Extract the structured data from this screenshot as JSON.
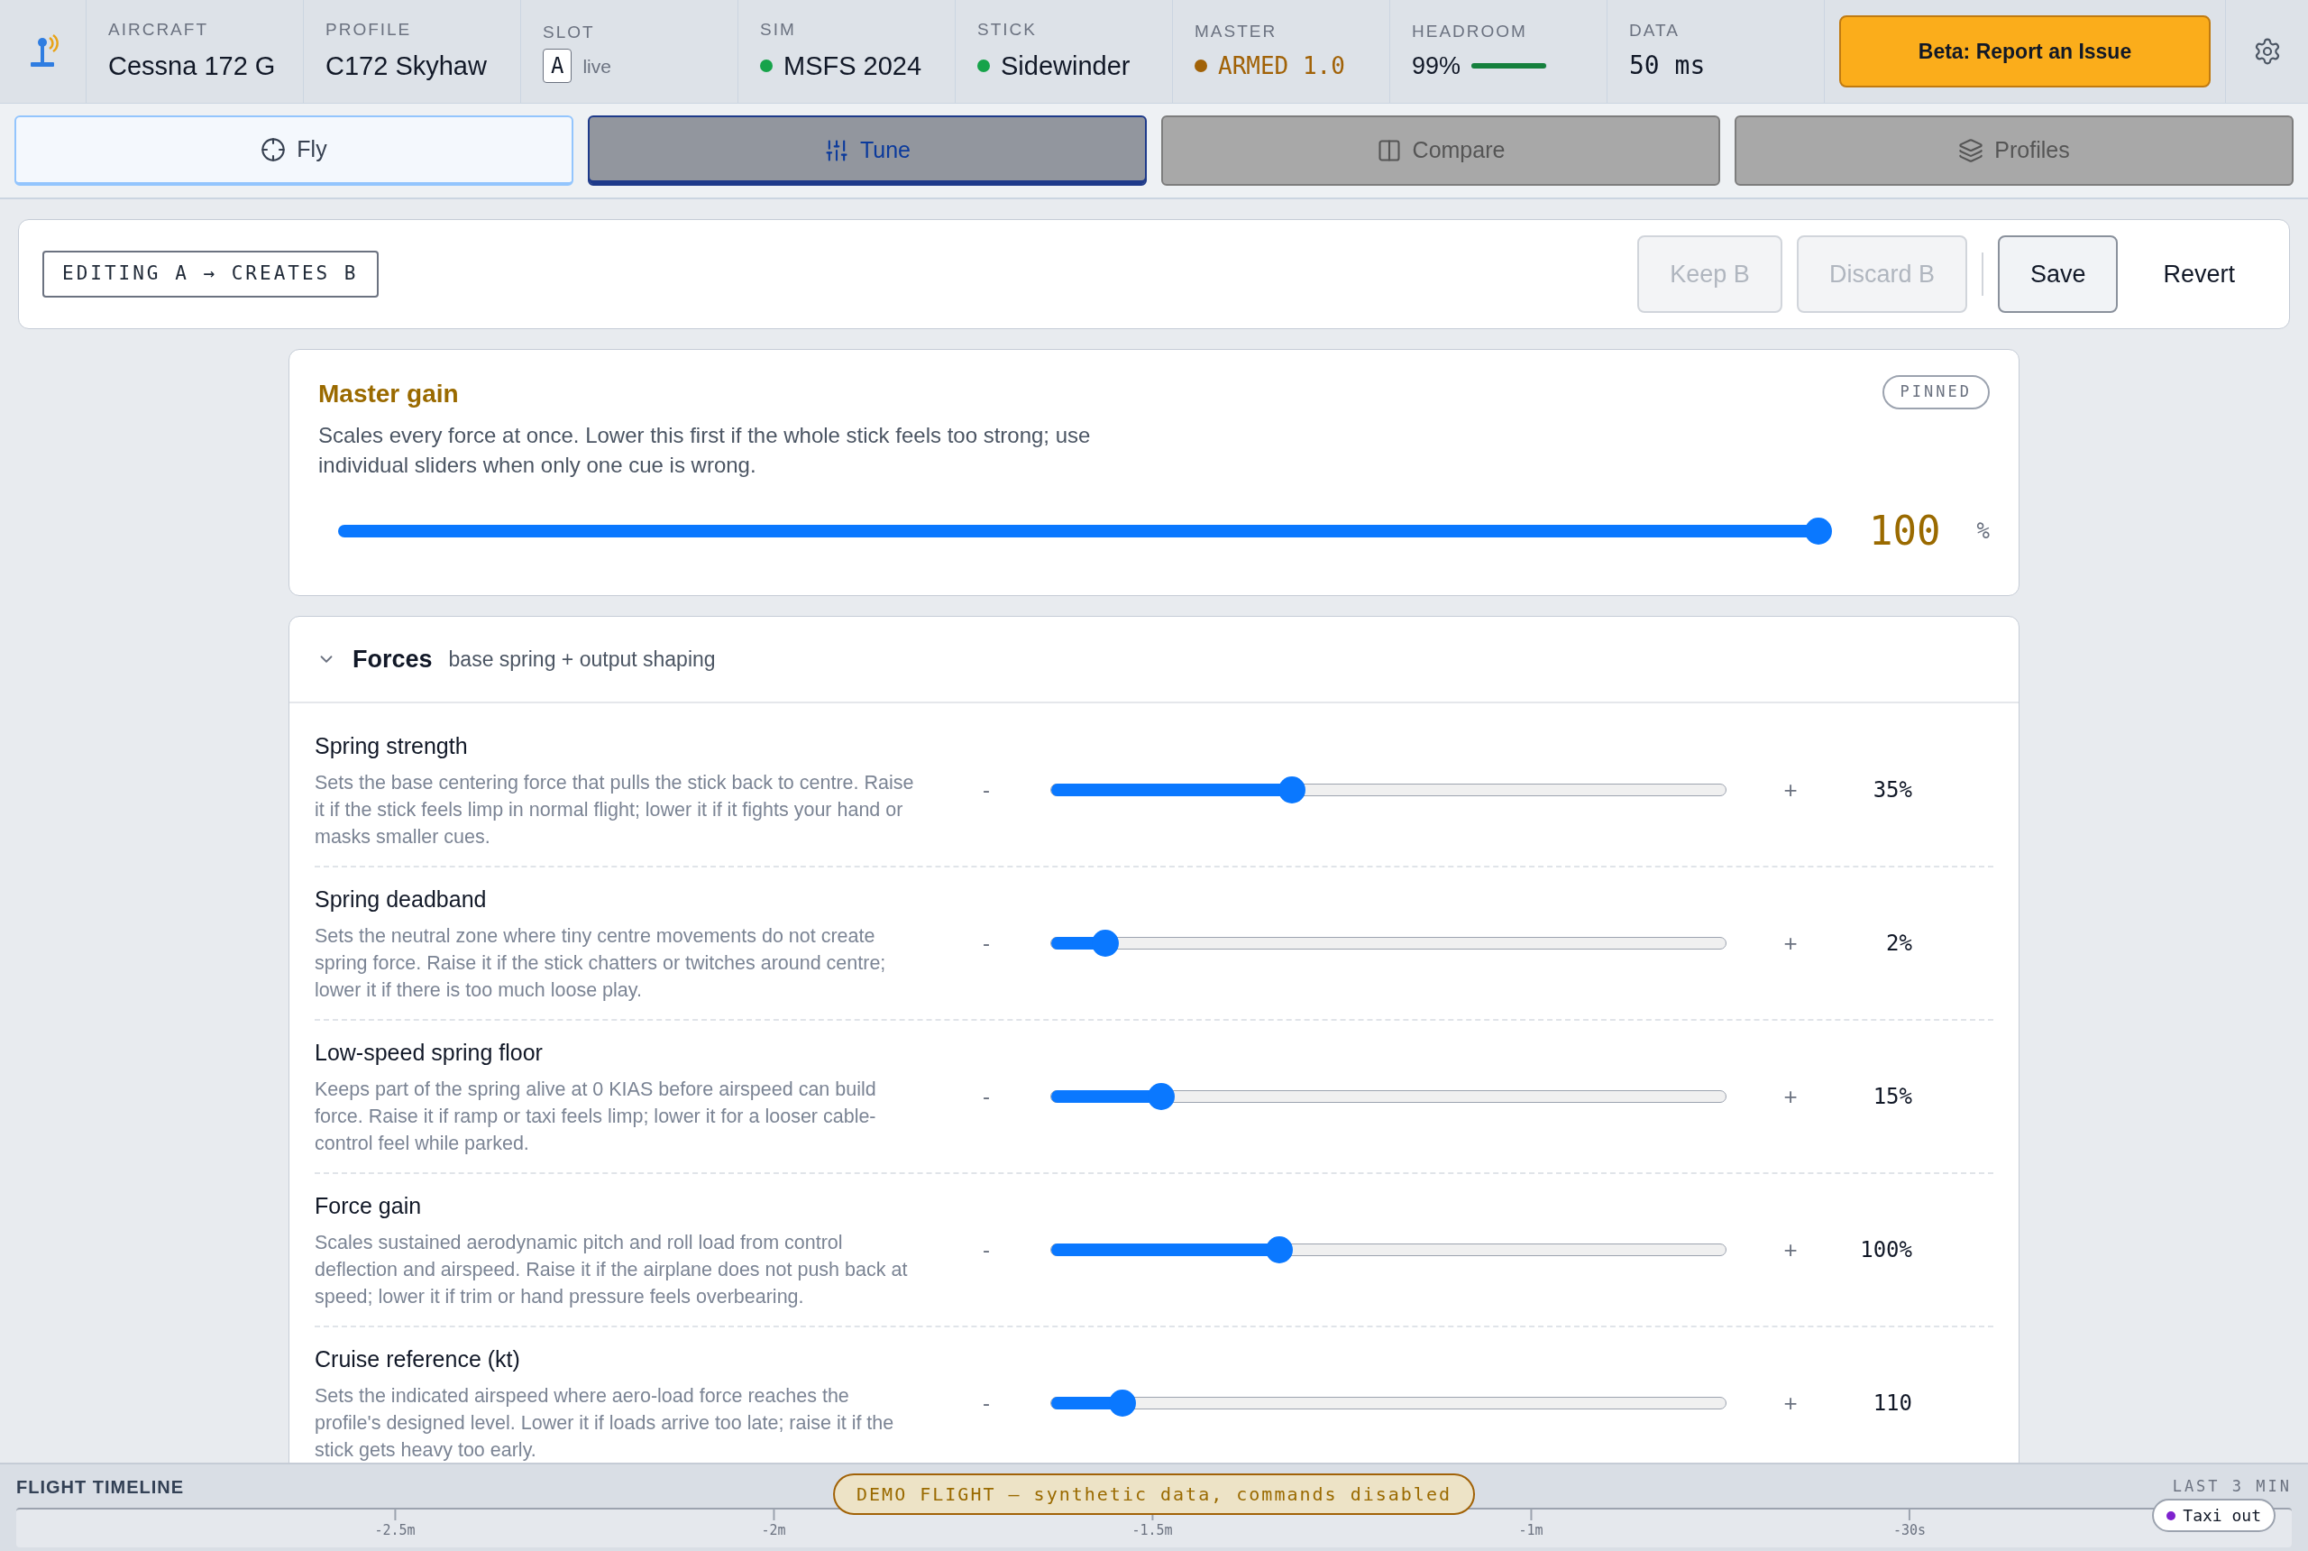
{
  "header": {
    "fields": [
      {
        "label": "AIRCRAFT",
        "value": "Cessna 172 G",
        "kind": "text"
      },
      {
        "label": "PROFILE",
        "value": "C172 Skyhaw",
        "kind": "text"
      },
      {
        "label": "SLOT",
        "slot": "A",
        "value": "live",
        "kind": "slot"
      },
      {
        "label": "SIM",
        "value": "MSFS 2024",
        "kind": "status",
        "color": "#16a34a"
      },
      {
        "label": "STICK",
        "value": "Sidewinder",
        "kind": "status",
        "color": "#16a34a"
      },
      {
        "label": "MASTER",
        "value": "ARMED 1.0",
        "kind": "armed",
        "color": "#a16207"
      },
      {
        "label": "HEADROOM",
        "value": "99%",
        "kind": "meter",
        "level": 0.99
      },
      {
        "label": "DATA",
        "value": "50 ms",
        "kind": "mono"
      }
    ],
    "report_button": "Beta: Report an Issue"
  },
  "tabs": [
    {
      "label": "Fly",
      "selected": true,
      "highlighted": false
    },
    {
      "label": "Tune",
      "selected": false,
      "highlighted": true
    },
    {
      "label": "Compare",
      "selected": false,
      "highlighted": false
    },
    {
      "label": "Profiles",
      "selected": false,
      "highlighted": false
    }
  ],
  "edit_bar": {
    "badge": "EDITING A → CREATES B",
    "buttons": [
      {
        "label": "Keep B",
        "disabled": true,
        "kind": "outline"
      },
      {
        "label": "Discard B",
        "disabled": true,
        "kind": "outline"
      },
      {
        "label": "Save",
        "disabled": false,
        "kind": "outline"
      },
      {
        "label": "Revert",
        "disabled": false,
        "kind": "plain"
      }
    ]
  },
  "master_gain": {
    "title": "Master gain",
    "badge": "PINNED",
    "description": "Scales every force at once. Lower this first if the whole stick feels too strong; use individual sliders when only one cue is wrong.",
    "level": 1.0,
    "value": "100",
    "unit": "%"
  },
  "forces": {
    "title": "Forces",
    "subtitle": "base spring + output shaping",
    "expanded": true,
    "rows": [
      {
        "name": "Spring strength",
        "description": "Sets the base centering force that pulls the stick back to centre. Raise it if the stick feels limp in normal flight; lower it if it fights your hand or masks smaller cues.",
        "minus": "-",
        "plus": "+",
        "level": 0.357,
        "value": "35%"
      },
      {
        "name": "Spring deadband",
        "description": "Sets the neutral zone where tiny centre movements do not create spring force. Raise it if the stick chatters or twitches around centre; lower it if there is too much loose play.",
        "minus": "-",
        "plus": "+",
        "level": 0.08,
        "value": "2%"
      },
      {
        "name": "Low-speed spring floor",
        "description": "Keeps part of the spring alive at 0 KIAS before airspeed can build force. Raise it if ramp or taxi feels limp; lower it for a looser cable-control feel while parked.",
        "minus": "-",
        "plus": "+",
        "level": 0.163,
        "value": "15%"
      },
      {
        "name": "Force gain",
        "description": "Scales sustained aerodynamic pitch and roll load from control deflection and airspeed. Raise it if the airplane does not push back at speed; lower it if trim or hand pressure feels overbearing.",
        "minus": "-",
        "plus": "+",
        "level": 0.338,
        "value": "100%"
      },
      {
        "name": "Cruise reference (kt)",
        "description": "Sets the indicated airspeed where aero-load force reaches the profile's designed level. Lower it if loads arrive too late; raise it if the stick gets heavy too early.",
        "minus": "-",
        "plus": "+",
        "level": 0.106,
        "value": "110"
      }
    ]
  },
  "timeline": {
    "title": "FLIGHT TIMELINE",
    "range": "LAST 3 MIN",
    "banner": "DEMO FLIGHT — synthetic data, commands disabled",
    "ticks": [
      "-2.5m",
      "-2m",
      "-1.5m",
      "-1m",
      "-30s"
    ],
    "event": {
      "label": "Taxi out",
      "color": "#7e22ce"
    }
  }
}
